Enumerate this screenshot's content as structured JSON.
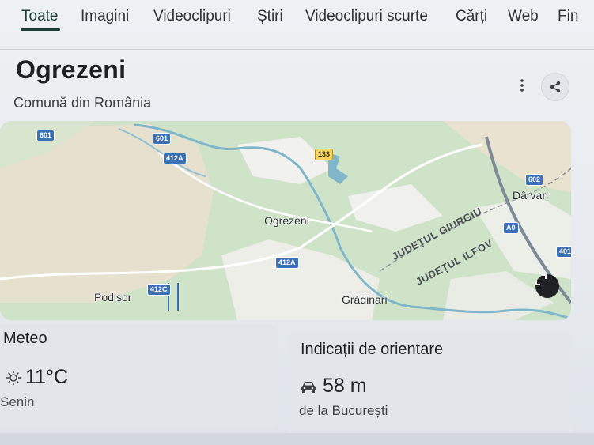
{
  "tabs": [
    "Toate",
    "Imagini",
    "Videoclipuri",
    "Știri",
    "Videoclipuri scurte",
    "Cărți",
    "Web",
    "Fin"
  ],
  "place": {
    "title": "Ogrezeni",
    "subtitle": "Comună din România"
  },
  "map": {
    "labels": {
      "ogrezeni": "Ogrezeni",
      "podisor": "Podișor",
      "gradinari": "Grădinari",
      "darvari": "Dârvari",
      "judet_giurgiu": "JUDEȚUL GIURGIU",
      "judet_ilfov": "JUDEȚUL ILFOV"
    },
    "road_shields": [
      "601",
      "601",
      "412A",
      "133",
      "602",
      "A0",
      "412A",
      "412C",
      "401"
    ]
  },
  "weather": {
    "title": "Meteo",
    "temperature": "11°C",
    "condition": "Senin"
  },
  "directions": {
    "title": "Indicații de orientare",
    "duration": "58 m",
    "from": "de la București"
  },
  "colors": {
    "accent": "#1a3d34",
    "card_bg": "#e2e6ea",
    "map_green": "#cfe3c8",
    "river": "#7fb6c9"
  }
}
